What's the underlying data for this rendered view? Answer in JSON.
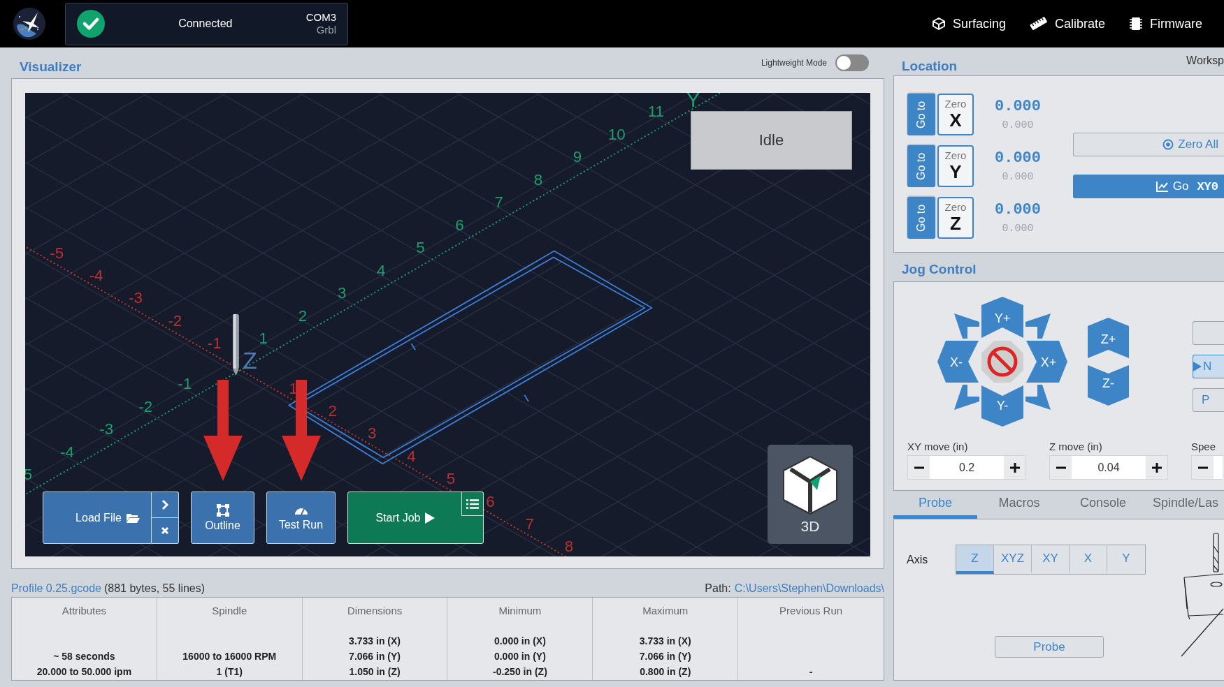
{
  "header": {
    "connection": {
      "connected": true,
      "status": "Connected",
      "port": "COM3",
      "firmware": "Grbl"
    },
    "nav": [
      {
        "kind": "surfacing",
        "label": "Surfacing"
      },
      {
        "kind": "calibrate",
        "label": "Calibrate"
      },
      {
        "kind": "firmware",
        "label": "Firmware"
      }
    ]
  },
  "visualizer": {
    "title": "Visualizer",
    "lightweight_mode": {
      "label": "Lightweight Mode",
      "on": false
    },
    "scene": {
      "y_axis_name": "Y",
      "z_axis_name": "Z",
      "y_axis_labels": [
        "5",
        "-4",
        "-3",
        "-2",
        "-1",
        "1",
        "2",
        "3",
        "4",
        "5",
        "6",
        "7",
        "8",
        "9",
        "10",
        "11"
      ],
      "x_axis_labels": [
        "-5",
        "-4",
        "-3",
        "-2",
        "-1",
        "1",
        "2",
        "3",
        "4",
        "5",
        "6",
        "7",
        "8"
      ]
    },
    "status": "Idle",
    "view_button": "3D",
    "job_buttons": [
      {
        "kind": "load",
        "label": "Load File",
        "highlighted": false
      },
      {
        "kind": "outline",
        "label": "Outline",
        "highlighted": true
      },
      {
        "kind": "test_run",
        "label": "Test Run",
        "highlighted": true
      },
      {
        "kind": "start",
        "label": "Start Job",
        "highlighted": false
      }
    ]
  },
  "file": {
    "name": "Profile 0.25.gcode",
    "details": "(881 bytes, 55 lines)",
    "path_label": "Path:",
    "path": "C:\\Users\\Stephen\\Downloads\\"
  },
  "stats": {
    "columns": [
      {
        "heading": "Attributes",
        "lines": [
          "~ 58 seconds",
          "20.000 to 50.000 ipm"
        ]
      },
      {
        "heading": "Spindle",
        "lines": [
          "16000 to 16000 RPM",
          "1 (T1)"
        ]
      },
      {
        "heading": "Dimensions",
        "lines": [
          "3.733 in (X)",
          "7.066 in (Y)",
          "1.050 in (Z)"
        ]
      },
      {
        "heading": "Minimum",
        "lines": [
          "0.000 in (X)",
          "0.000 in (Y)",
          "-0.250 in (Z)"
        ]
      },
      {
        "heading": "Maximum",
        "lines": [
          "3.733 in (X)",
          "7.066 in (Y)",
          "0.800 in (Z)"
        ]
      },
      {
        "heading": "Previous Run",
        "lines": [
          "-"
        ]
      }
    ]
  },
  "location": {
    "title": "Location",
    "workspace": "Worksp",
    "axes": [
      {
        "axis": "X",
        "goto": "Go to",
        "zero": "Zero",
        "work": "0.000",
        "machine": "0.000"
      },
      {
        "axis": "Y",
        "goto": "Go to",
        "zero": "Zero",
        "work": "0.000",
        "machine": "0.000"
      },
      {
        "axis": "Z",
        "goto": "Go to",
        "zero": "Zero",
        "work": "0.000",
        "machine": "0.000"
      }
    ],
    "zero_all": "Zero All",
    "go_zero": {
      "label": "Go",
      "code": "XY0"
    }
  },
  "jog": {
    "title": "Jog Control",
    "buttons": [
      {
        "kind": "y_plus",
        "label": "Y+"
      },
      {
        "kind": "x_minus",
        "label": "X-"
      },
      {
        "kind": "x_plus",
        "label": "X+"
      },
      {
        "kind": "y_minus",
        "label": "Y-"
      },
      {
        "kind": "z_plus",
        "label": "Z+"
      },
      {
        "kind": "z_minus",
        "label": "Z-"
      }
    ],
    "side_buttons": [
      {
        "selected": false
      },
      {
        "label": "N",
        "selected": true
      },
      {
        "label": "P",
        "selected": false
      }
    ],
    "steppers": [
      {
        "label": "XY move (in)",
        "value": "0.2"
      },
      {
        "label": "Z move (in)",
        "value": "0.04"
      },
      {
        "label": "Spee"
      }
    ]
  },
  "tabs": [
    {
      "label": "Probe",
      "selected": true
    },
    {
      "label": "Macros",
      "selected": false
    },
    {
      "label": "Console",
      "selected": false
    },
    {
      "label": "Spindle/Las",
      "selected": false
    }
  ],
  "probe": {
    "axis_label": "Axis",
    "axes": [
      {
        "label": "Z",
        "selected": true
      },
      {
        "label": "XYZ",
        "selected": false
      },
      {
        "label": "XY",
        "selected": false
      },
      {
        "label": "X",
        "selected": false
      },
      {
        "label": "Y",
        "selected": false
      }
    ],
    "button": "Probe"
  }
}
